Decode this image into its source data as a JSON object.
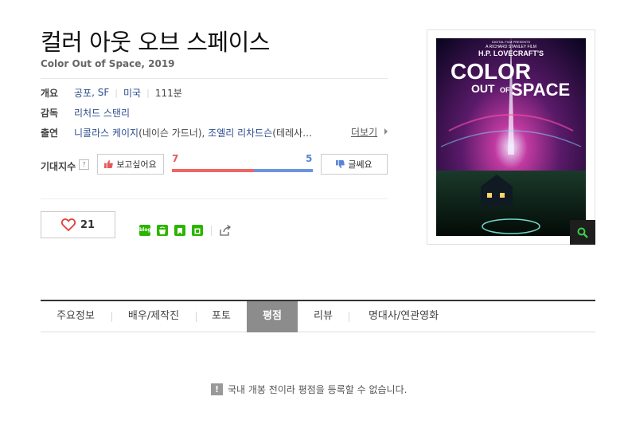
{
  "movie": {
    "title_ko": "컬러 아웃 오브 스페이스",
    "subtitle": "Color Out of Space, 2019"
  },
  "info": {
    "overview_label": "개요",
    "genre1": "공포",
    "genre_sep": ",",
    "genre2": "SF",
    "country": "미국",
    "runtime": "111분",
    "director_label": "감독",
    "director": "리처드 스탠리",
    "cast_label": "출연",
    "cast1": "니콜라스 케이지",
    "cast1_role": "(네이슨 가드너),",
    "cast2": "조엘리 리차드슨",
    "cast2_role": "(테레사…",
    "more_label": "더보기"
  },
  "expectation": {
    "label": "기대지수",
    "help": "?",
    "want_label": "보고싶어요",
    "want_count": "7",
    "no_count": "5",
    "want_fraction": 0.583,
    "no_label": "글쎄요"
  },
  "actions": {
    "like_count": "21",
    "blog_icon_text": "blog"
  },
  "poster": {
    "top_credit": "DIGITAL FILM PRESENTS",
    "studio_line": "A RICHARD STANLEY FILM",
    "line1": "H.P. LOVECRAFT'S",
    "line2": "COLOR",
    "line3": "OUT",
    "line4": "OF",
    "line5": "SPACE"
  },
  "tabs": [
    {
      "label": "주요정보",
      "active": false
    },
    {
      "label": "배우/제작진",
      "active": false
    },
    {
      "label": "포토",
      "active": false
    },
    {
      "label": "평점",
      "active": true
    },
    {
      "label": "리뷰",
      "active": false
    },
    {
      "label": "명대사/연관영화",
      "active": false
    }
  ],
  "notice": {
    "icon": "!",
    "text": "국내 개봉 전이라 평점을 등록할 수 없습니다."
  },
  "colors": {
    "link": "#2d4d8f",
    "gauge_want": "#ef6464",
    "gauge_no": "#6c93e0",
    "naver_green": "#2cb400",
    "tab_active": "#8c8c8c"
  }
}
